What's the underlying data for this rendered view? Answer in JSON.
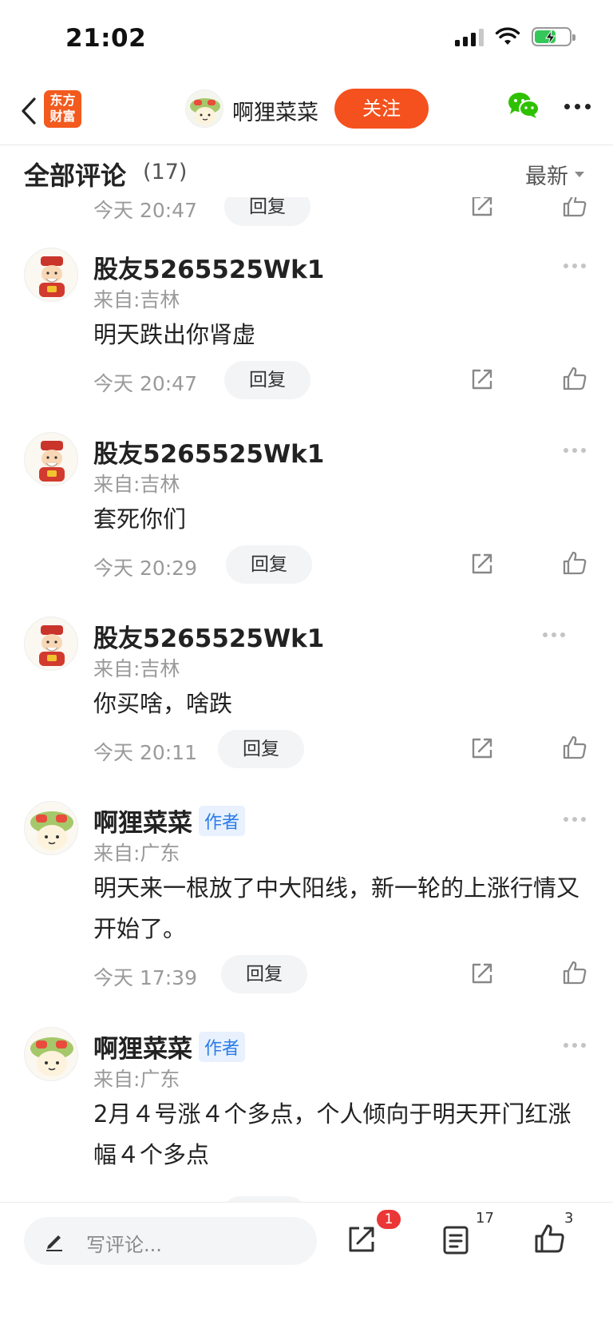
{
  "status_bar": {
    "time": "21:02"
  },
  "nav": {
    "logo_line1": "东方",
    "logo_line2": "财富",
    "username": "啊狸菜菜",
    "follow_label": "关注"
  },
  "comments_header": {
    "title": "全部评论",
    "count": "(17)",
    "sort_label": "最新"
  },
  "top_partial": {
    "time": "今天 20:47",
    "reply_label": "回复"
  },
  "comments": [
    {
      "name": "股友5265525Wk1",
      "badge": "",
      "location": "来自:吉林",
      "text": "明天跌出你肾虚",
      "time": "今天 20:47",
      "reply_label": "回复"
    },
    {
      "name": "股友5265525Wk1",
      "badge": "",
      "location": "来自:吉林",
      "text": "套死你们",
      "time": "今天 20:29",
      "reply_label": "回复"
    },
    {
      "name": "股友5265525Wk1",
      "badge": "",
      "location": "来自:吉林",
      "text": "你买啥，啥跌",
      "time": "今天 20:11",
      "reply_label": "回复"
    },
    {
      "name": "啊狸菜菜",
      "badge": "作者",
      "location": "来自:广东",
      "text": "明天来一根放了中大阳线，新一轮的上涨行情又开始了。",
      "time": "今天 17:39",
      "reply_label": "回复"
    },
    {
      "name": "啊狸菜菜",
      "badge": "作者",
      "location": "来自:广东",
      "text": "2月４号涨４个多点，个人倾向于明天开门红涨幅４个多点",
      "time": "",
      "reply_label": ""
    }
  ],
  "bottom_bar": {
    "input_placeholder": "写评论...",
    "share_badge": "1",
    "comment_count": "17",
    "like_count": "3"
  },
  "colors": {
    "accent": "#f4511e",
    "badge_blue": "#2b7ce9",
    "wechat_green": "#2dc100"
  }
}
